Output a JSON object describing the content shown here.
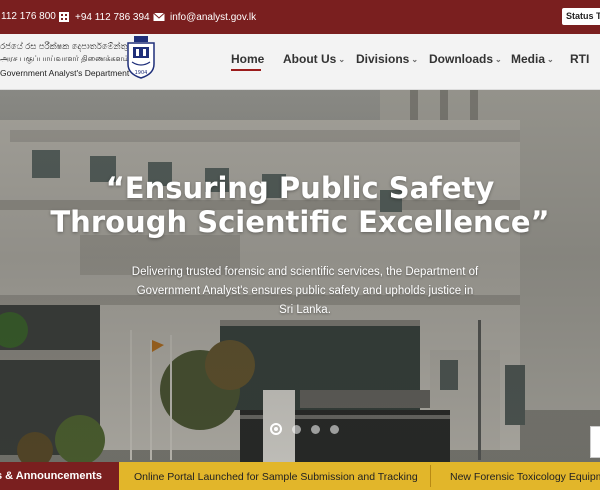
{
  "topbar": {
    "phone1": "112 176 800",
    "fax": "+94 112 786 394",
    "email": "info@analyst.gov.lk",
    "status_button": "Status Tr"
  },
  "brand": {
    "line_sinhala": "රජයේ රස පරීක්ෂක දෙපාර්තමේන්තුව",
    "line_tamil": "அரச பகுப்பாய்வாளர் திணைக்களம்",
    "line_english": "Government Analyst's Department",
    "emblem_year": "1904"
  },
  "nav": {
    "home": "Home",
    "about": "About Us",
    "divisions": "Divisions",
    "downloads": "Downloads",
    "media": "Media",
    "rti": "RTI"
  },
  "hero": {
    "title_line1": "“Ensuring Public Safety",
    "title_line2": "Through Scientific Excellence”",
    "subtitle": "Delivering trusted forensic and scientific services, the Department of Government Analyst's ensures public safety and upholds justice in Sri Lanka.",
    "slides": 4,
    "active_slide": 1
  },
  "ticker": {
    "label": "s & Announcements",
    "items": [
      "Online Portal Launched for Sample Submission and Tracking",
      "New Forensic Toxicology Equipme"
    ]
  },
  "colors": {
    "primary_maroon": "#7a1f1f",
    "ticker_gold": "#e2b62a",
    "header_bg": "#f3f3f3"
  }
}
